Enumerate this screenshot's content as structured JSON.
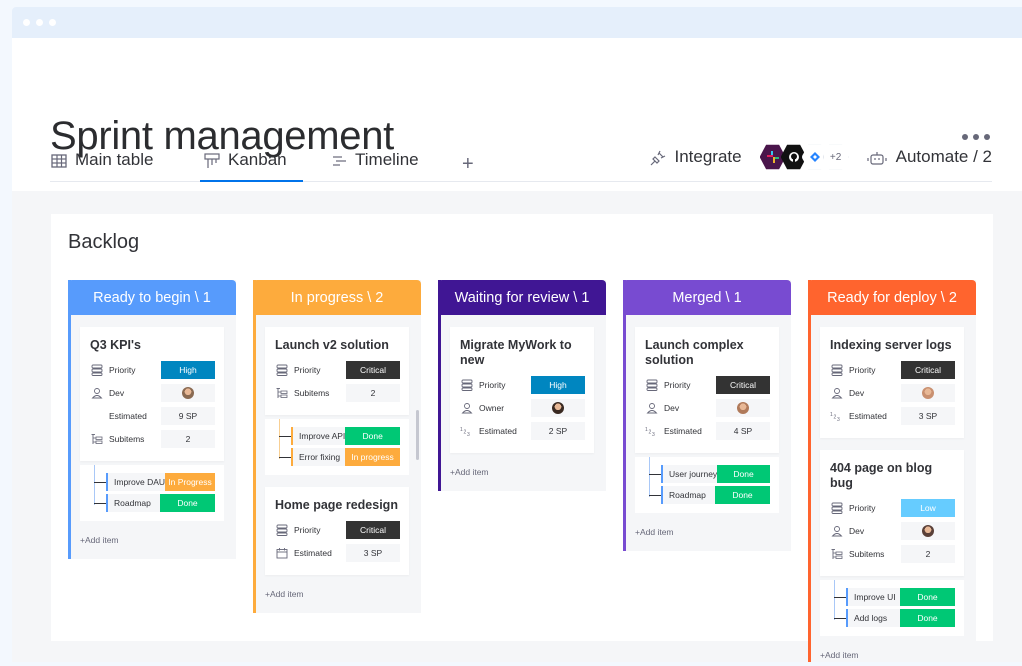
{
  "window": {
    "title_dots": 3
  },
  "header": {
    "title": "Sprint management",
    "more_label": "More options"
  },
  "tabs": [
    {
      "label": "Main table",
      "icon": "table-icon",
      "active": false
    },
    {
      "label": "Kanban",
      "icon": "kanban-icon",
      "active": true
    },
    {
      "label": "Timeline",
      "icon": "timeline-icon",
      "active": false
    }
  ],
  "add_view_label": "+",
  "toolbar": {
    "integrate_label": "Integrate",
    "integrations": [
      "slack",
      "github",
      "jira"
    ],
    "integrations_more": "+2",
    "automate_label": "Automate / 2"
  },
  "board": {
    "title": "Backlog",
    "add_item_label": "+Add item",
    "columns": [
      {
        "title": "Ready to begin \\ 1",
        "color": "#579bfc",
        "cards": [
          {
            "title": "Q3 KPI's",
            "fields": [
              {
                "label": "Priority",
                "icon": "priority-icon",
                "value": "High",
                "color": "#0086c0"
              },
              {
                "label": "Dev",
                "icon": "person-icon",
                "value": "avatar"
              },
              {
                "label": "Estimated",
                "icon": "",
                "value": "9 SP"
              },
              {
                "label": "Subitems",
                "icon": "subitems-icon",
                "value": "2"
              }
            ],
            "subitems": [
              {
                "name": "Improve DAU",
                "status": "In Progress",
                "color": "#fdab3d"
              },
              {
                "name": "Roadmap",
                "status": "Done",
                "color": "#00c875"
              }
            ]
          }
        ]
      },
      {
        "title": "In progress \\ 2",
        "color": "#fdab3d",
        "cards": [
          {
            "title": "Launch v2 solution",
            "fields": [
              {
                "label": "Priority",
                "icon": "priority-icon",
                "value": "Critical",
                "color": "#333333"
              },
              {
                "label": "Subitems",
                "icon": "subitems-icon",
                "value": "2"
              }
            ],
            "subitems": [
              {
                "name": "Improve API",
                "status": "Done",
                "color": "#00c875"
              },
              {
                "name": "Error fixing",
                "status": "In progress",
                "color": "#fdab3d"
              }
            ]
          },
          {
            "title": "Home page redesign",
            "fields": [
              {
                "label": "Priority",
                "icon": "priority-icon",
                "value": "Critical",
                "color": "#333333"
              },
              {
                "label": "Estimated",
                "icon": "calendar-icon",
                "value": "3 SP"
              }
            ]
          }
        ]
      },
      {
        "title": "Waiting for review \\ 1",
        "color": "#401694",
        "cards": [
          {
            "title": "Migrate MyWork to new",
            "fields": [
              {
                "label": "Priority",
                "icon": "priority-icon",
                "value": "High",
                "color": "#0086c0"
              },
              {
                "label": "Owner",
                "icon": "person-icon",
                "value": "avatar"
              },
              {
                "label": "Estimated",
                "icon": "numbers-icon",
                "value": "2 SP"
              }
            ]
          }
        ]
      },
      {
        "title": "Merged \\ 1",
        "color": "#784bd1",
        "cards": [
          {
            "title": "Launch complex solution",
            "fields": [
              {
                "label": "Priority",
                "icon": "priority-icon",
                "value": "Critical",
                "color": "#333333"
              },
              {
                "label": "Dev",
                "icon": "person-icon",
                "value": "avatar"
              },
              {
                "label": "Estimated",
                "icon": "numbers-icon",
                "value": "4 SP"
              }
            ],
            "subitems": [
              {
                "name": "User journey",
                "status": "Done",
                "color": "#00c875"
              },
              {
                "name": "Roadmap",
                "status": "Done",
                "color": "#00c875"
              }
            ]
          }
        ]
      },
      {
        "title": "Ready for deploy \\ 2",
        "color": "#ff642e",
        "cards": [
          {
            "title": "Indexing server logs",
            "fields": [
              {
                "label": "Priority",
                "icon": "priority-icon",
                "value": "Critical",
                "color": "#333333"
              },
              {
                "label": "Dev",
                "icon": "person-icon",
                "value": "avatar"
              },
              {
                "label": "Estimated",
                "icon": "numbers-icon",
                "value": "3 SP"
              }
            ]
          },
          {
            "title": "404 page on blog bug",
            "fields": [
              {
                "label": "Priority",
                "icon": "priority-icon",
                "value": "Low",
                "color": "#66ccff"
              },
              {
                "label": "Dev",
                "icon": "person-icon",
                "value": "avatar"
              },
              {
                "label": "Subitems",
                "icon": "subitems-icon",
                "value": "2"
              }
            ],
            "subitems": [
              {
                "name": "Improve UI",
                "status": "Done",
                "color": "#00c875"
              },
              {
                "name": "Add logs",
                "status": "Done",
                "color": "#00c875"
              }
            ]
          }
        ]
      }
    ]
  }
}
